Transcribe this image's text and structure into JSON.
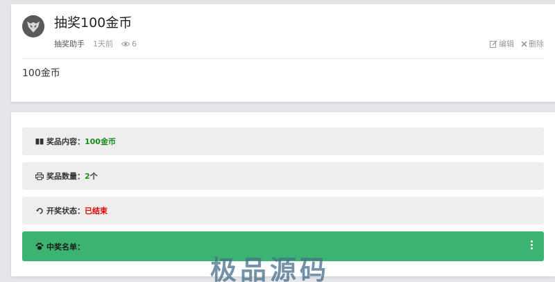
{
  "post": {
    "title": "抽奖100金币",
    "author": "抽奖助手",
    "time": "1天前",
    "views": "6",
    "edit_label": "编辑",
    "delete_label": "删除",
    "content": "100金币"
  },
  "lottery": {
    "prize_label": "奖品内容：",
    "prize_value": "100金币",
    "qty_label": "奖品数量：",
    "qty_value": "2",
    "qty_unit": " 个",
    "status_label": "开奖状态：",
    "status_value": "已结束",
    "winners_label": "中奖名单："
  },
  "watermark": "极品源码",
  "colors": {
    "page_bg": "#e4e6ea",
    "prize_green": "#1a8a1a",
    "qty_green": "#1a8a1a",
    "status_red": "#e00000",
    "winners_bar": "#3cb371",
    "watermark": "#466e8c"
  },
  "icons": {
    "views": "eye-icon",
    "edit": "edit-icon",
    "delete": "close-icon",
    "prize": "gift-icon",
    "qty": "print-icon",
    "status": "refresh-icon",
    "winners": "paw-icon",
    "more": "vertical-dots-icon"
  }
}
